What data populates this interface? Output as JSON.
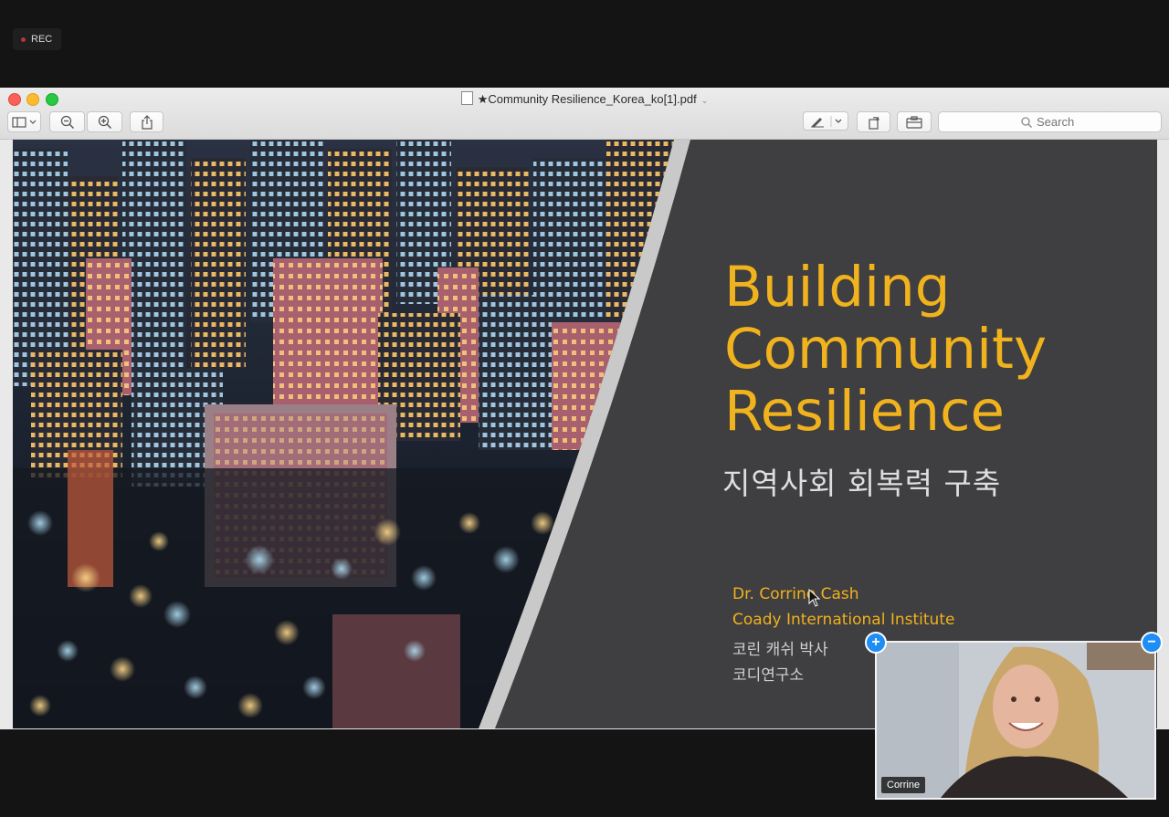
{
  "recording": {
    "label": "REC"
  },
  "window": {
    "title": "★Community Resilience_Korea_ko[1].pdf",
    "search_placeholder": "Search"
  },
  "slide": {
    "title_lines": [
      "Building",
      "Community",
      "Resilience"
    ],
    "subtitle": "지역사회 회복력 구축",
    "author_en": "Dr. Corrine Cash",
    "institute_en": "Coady International Institute",
    "author_ko": "코린 캐쉬 박사",
    "institute_ko": "코디연구소",
    "accent_color": "#f0b21d",
    "background_color": "#3f3e40"
  },
  "video_tile": {
    "participant_name": "Corrine",
    "expand_icon": "plus-icon",
    "collapse_icon": "minus-icon"
  }
}
